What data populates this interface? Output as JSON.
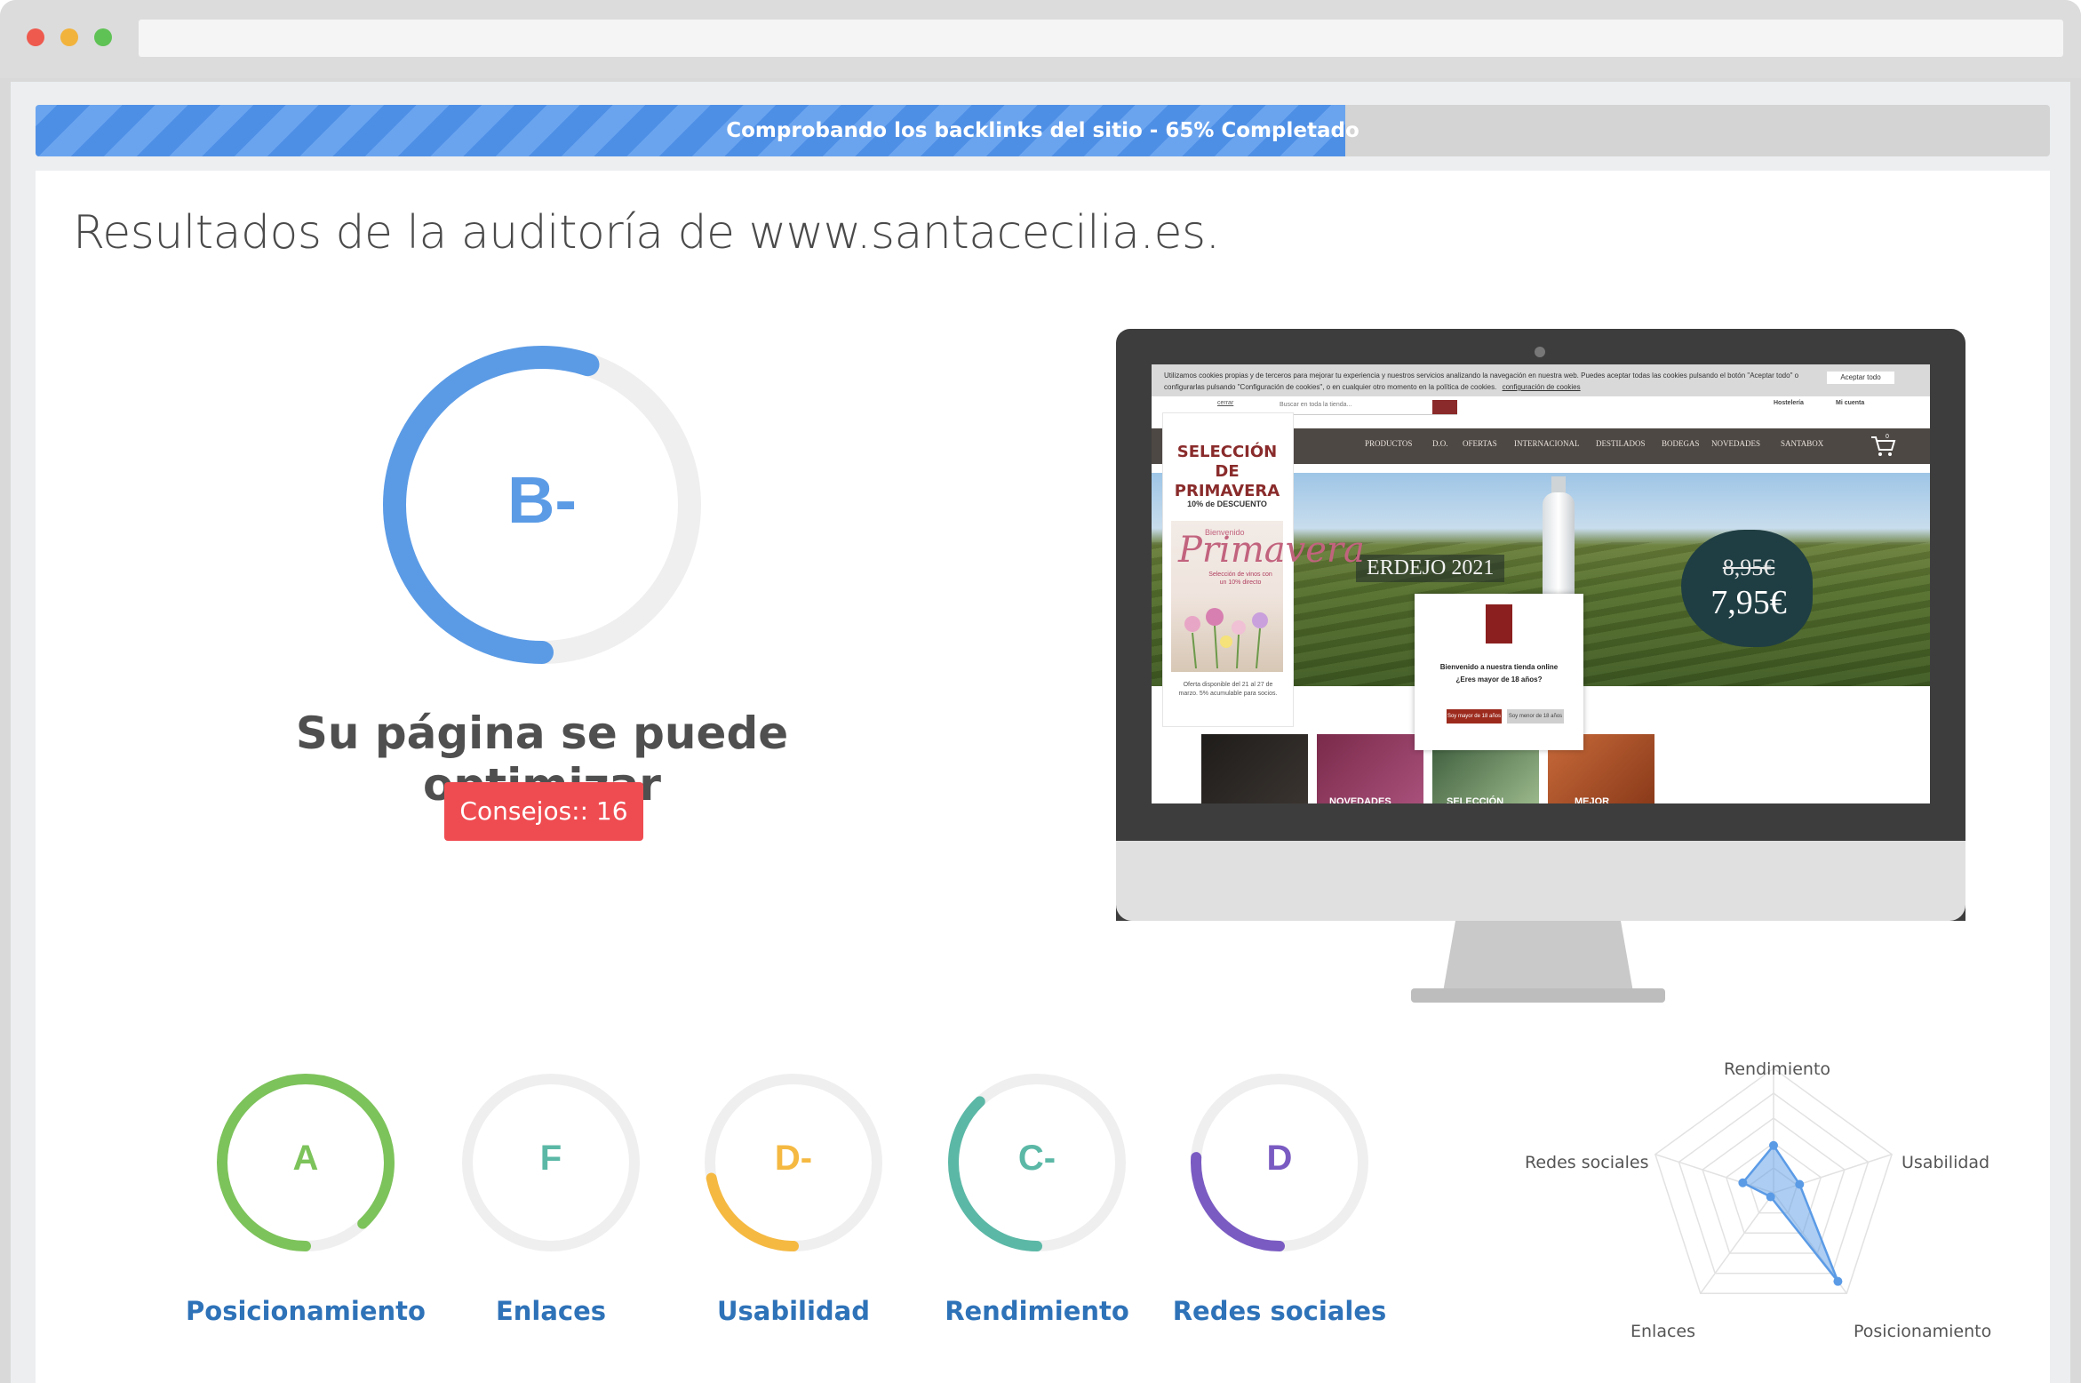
{
  "browser": {
    "dot_colors": [
      "#ee5a4e",
      "#f2b33d",
      "#5fc255"
    ]
  },
  "progress": {
    "text": "Comprobando los backlinks del sitio - 65% Completado",
    "percent": 65
  },
  "audit": {
    "title": "Resultados de la auditoría de www.santacecilia.es.",
    "grade": "B-",
    "grade_fraction": 0.55,
    "grade_color": "#5b9be6",
    "message": "Su página se puede optimizar",
    "tips_button": "Consejos:: 16"
  },
  "site_preview": {
    "cookie_text": "Utilizamos cookies propias y de terceros para mejorar tu experiencia y nuestros servicios analizando la navegación en nuestra web. Puedes aceptar todas las cookies pulsando el botón \"Aceptar todo\" o configurarlas pulsando \"Configuración de cookies\", o en cualquier otro momento en la política de cookies.",
    "cookie_config": "configuración de cookies",
    "accept_button": "Aceptar todo",
    "search_placeholder": "Buscar en toda la tienda...",
    "account_links": [
      "Hostelería",
      "Mi cuenta"
    ],
    "close_link": "cerrar",
    "nav_items": [
      "PRODUCTOS",
      "D.O.",
      "OFERTAS",
      "INTERNACIONAL",
      "DESTILADOS",
      "BODEGAS",
      "NOVEDADES",
      "SANTABOX"
    ],
    "cart_count": "0",
    "promo_title": "SELECCIÓN DE PRIMAVERA",
    "promo_discount": "10% de DESCUENTO",
    "promo_script": "Primavera",
    "promo_welcome": "Bienvenido",
    "promo_note": "Selección de vinos con un 10% directo",
    "promo_footer": "Oferta disponible del 21 al 27 de marzo. 5% acumulable para socios.",
    "hero_caption": "ERDEJO 2021",
    "price_old": "8,95€",
    "price_new": "7,95€",
    "modal_text_1": "Bienvenido a nuestra tienda online",
    "modal_text_2": "¿Eres mayor de 18 años?",
    "modal_yes": "Soy mayor de 18 años",
    "modal_no": "Soy menor de 18 años",
    "thumb_texts": [
      "",
      "NOVEDADES",
      "SELECCIÓN",
      "MEJOR"
    ]
  },
  "categories": [
    {
      "label": "Posicionamiento",
      "grade": "A",
      "color": "#7dc35b",
      "fraction": 0.88
    },
    {
      "label": "Enlaces",
      "grade": "F",
      "color": "#5bb8a6",
      "fraction": 0.0
    },
    {
      "label": "Usabilidad",
      "grade": "D-",
      "color": "#f5b942",
      "fraction": 0.22
    },
    {
      "label": "Rendimiento",
      "grade": "C-",
      "color": "#5bb8a6",
      "fraction": 0.38
    },
    {
      "label": "Redes sociales",
      "grade": "D",
      "color": "#7a5bc2",
      "fraction": 0.26
    }
  ],
  "radar": {
    "labels": [
      "Rendimiento",
      "Usabilidad",
      "Posicionamiento",
      "Enlaces",
      "Redes sociales"
    ],
    "values": [
      0.38,
      0.22,
      0.88,
      0.0,
      0.26
    ],
    "color": "#5b9be6"
  }
}
